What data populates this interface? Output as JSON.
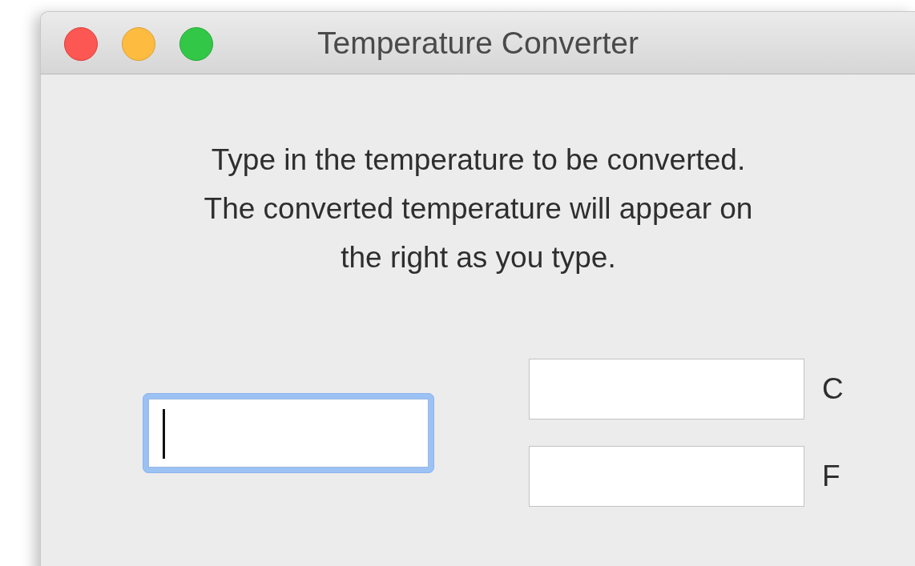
{
  "window": {
    "title": "Temperature Converter"
  },
  "instructions": "Type in the temperature to be converted.\nThe converted temperature will appear on\nthe right as you type.",
  "input": {
    "focused": true
  },
  "outputs": [
    {
      "label": "C"
    },
    {
      "label": "F"
    }
  ]
}
